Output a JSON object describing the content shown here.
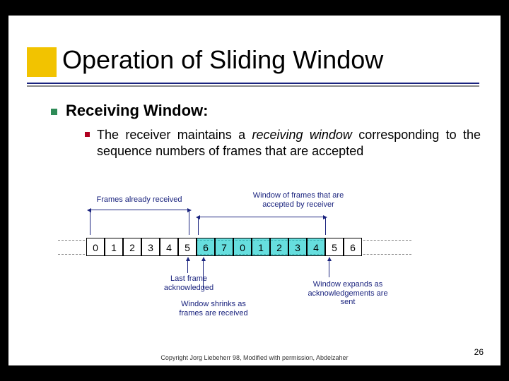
{
  "slide": {
    "title": "Operation of Sliding Window",
    "bullet1": "Receiving Window:",
    "bullet2_a": "The receiver maintains a ",
    "bullet2_italic": "receiving window",
    "bullet2_b": " corresponding to the sequence numbers of frames that are accepted"
  },
  "diagram": {
    "label_frames_received": "Frames already received",
    "label_window_accepted": "Window of frames that are\naccepted by receiver",
    "label_last_ack": "Last frame\nacknowledged",
    "label_shrinks": "Window shrinks as\nframes are received",
    "label_expands": "Window expands as\nacknowledgements are\nsent",
    "cells": [
      {
        "v": "0",
        "hl": false
      },
      {
        "v": "1",
        "hl": false
      },
      {
        "v": "2",
        "hl": false
      },
      {
        "v": "3",
        "hl": false
      },
      {
        "v": "4",
        "hl": false
      },
      {
        "v": "5",
        "hl": false
      },
      {
        "v": "6",
        "hl": true
      },
      {
        "v": "7",
        "hl": true
      },
      {
        "v": "0",
        "hl": true
      },
      {
        "v": "1",
        "hl": true
      },
      {
        "v": "2",
        "hl": true
      },
      {
        "v": "3",
        "hl": true
      },
      {
        "v": "4",
        "hl": true
      },
      {
        "v": "5",
        "hl": false
      },
      {
        "v": "6",
        "hl": false
      }
    ]
  },
  "footer": {
    "copyright": "Copyright Jorg Liebeherr 98, Modified with permission, Abdelzaher",
    "page": "26"
  }
}
